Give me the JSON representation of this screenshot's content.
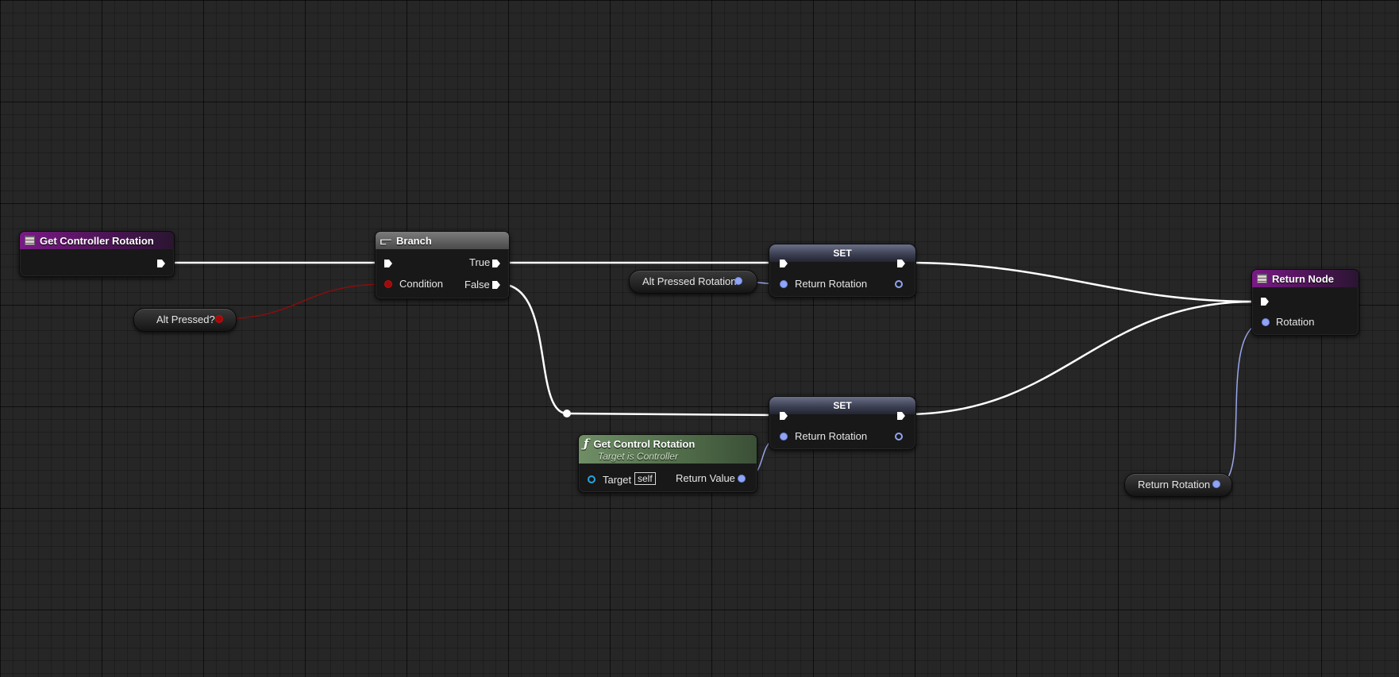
{
  "graph": {
    "wire_colors": {
      "exec": "#ffffff",
      "rotator": "#9aa6ea",
      "bool": "#8a0d0d"
    }
  },
  "nodes": {
    "get_controller_rotation": {
      "title": "Get Controller Rotation",
      "header_color": "#7a1a86"
    },
    "branch": {
      "title": "Branch",
      "pins": {
        "condition": "Condition",
        "true": "True",
        "false": "False"
      }
    },
    "set_top": {
      "title": "SET",
      "pin_label": "Return Rotation"
    },
    "set_bottom": {
      "title": "SET",
      "pin_label": "Return Rotation"
    },
    "get_control_rotation": {
      "title": "Get Control Rotation",
      "subtitle": "Target is Controller",
      "target_label": "Target",
      "target_default": "self",
      "return_label": "Return Value",
      "header_color": "#5f7e57"
    },
    "return_node": {
      "title": "Return Node",
      "pin_label": "Rotation",
      "header_color": "#7a1a86"
    }
  },
  "variables": {
    "alt_pressed": "Alt Pressed?",
    "alt_pressed_rotation": "Alt Pressed Rotation",
    "return_rotation": "Return Rotation"
  }
}
